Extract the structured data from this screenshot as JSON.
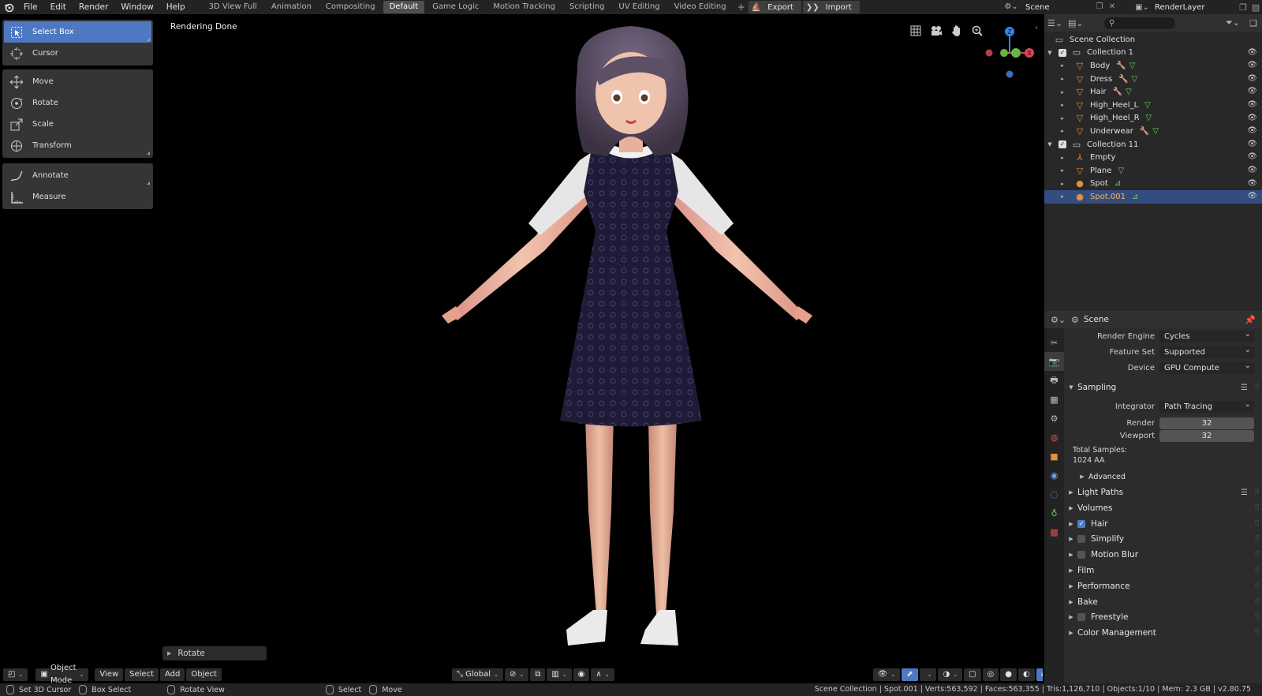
{
  "menu": [
    "File",
    "Edit",
    "Render",
    "Window",
    "Help"
  ],
  "workspaces": [
    {
      "label": "3D View Full",
      "active": false
    },
    {
      "label": "Animation",
      "active": false
    },
    {
      "label": "Compositing",
      "active": false
    },
    {
      "label": "Default",
      "active": true
    },
    {
      "label": "Game Logic",
      "active": false
    },
    {
      "label": "Motion Tracking",
      "active": false
    },
    {
      "label": "Scripting",
      "active": false
    },
    {
      "label": "UV Editing",
      "active": false
    },
    {
      "label": "Video Editing",
      "active": false
    }
  ],
  "topbar": {
    "export_label": "Export",
    "import_label": "Import",
    "scene_name": "Scene",
    "view_layer": "RenderLayer"
  },
  "viewport": {
    "status": "Rendering Done",
    "redo_panel": "Rotate"
  },
  "tools": [
    {
      "group": 1,
      "label": "Select Box",
      "icon": "select-box-icon",
      "active": true
    },
    {
      "group": 1,
      "label": "Cursor",
      "icon": "cursor-icon",
      "active": false
    },
    {
      "group": 2,
      "label": "Move",
      "icon": "move-icon",
      "active": false
    },
    {
      "group": 2,
      "label": "Rotate",
      "icon": "rotate-icon",
      "active": false
    },
    {
      "group": 2,
      "label": "Scale",
      "icon": "scale-icon",
      "active": false
    },
    {
      "group": 2,
      "label": "Transform",
      "icon": "transform-icon",
      "active": false
    },
    {
      "group": 3,
      "label": "Annotate",
      "icon": "annotate-icon",
      "active": false
    },
    {
      "group": 3,
      "label": "Measure",
      "icon": "measure-icon",
      "active": false
    }
  ],
  "gizmo": {
    "z": "Z",
    "x": "X"
  },
  "vp_header": {
    "mode": "Object Mode",
    "view": "View",
    "select": "Select",
    "add": "Add",
    "object": "Object",
    "orientation": "Global"
  },
  "outliner": {
    "root": "Scene Collection",
    "rows": [
      {
        "label": "Collection 1",
        "level": 1,
        "type": "collection",
        "expanded": true
      },
      {
        "label": "Body",
        "level": 2,
        "type": "mesh",
        "mods": [
          "wrench",
          "tri"
        ]
      },
      {
        "label": "Dress",
        "level": 2,
        "type": "mesh",
        "mods": [
          "wrench",
          "tri"
        ]
      },
      {
        "label": "Hair",
        "level": 2,
        "type": "mesh",
        "mods": [
          "wrench",
          "tri"
        ]
      },
      {
        "label": "High_Heel_L",
        "level": 2,
        "type": "mesh",
        "mods": [
          "tri"
        ]
      },
      {
        "label": "High_Heel_R",
        "level": 2,
        "type": "mesh",
        "mods": [
          "tri"
        ]
      },
      {
        "label": "Underwear",
        "level": 2,
        "type": "mesh",
        "mods": [
          "wrench",
          "tri"
        ]
      },
      {
        "label": "Collection 11",
        "level": 1,
        "type": "collection",
        "expanded": true
      },
      {
        "label": "Empty",
        "level": 2,
        "type": "empty",
        "mods": []
      },
      {
        "label": "Plane",
        "level": 2,
        "type": "mesh",
        "mods": [
          "tri"
        ]
      },
      {
        "label": "Spot",
        "level": 2,
        "type": "light",
        "mods": [
          "light-data"
        ]
      },
      {
        "label": "Spot.001",
        "level": 2,
        "type": "light",
        "mods": [
          "light-data"
        ],
        "selected": true
      }
    ]
  },
  "properties": {
    "context": "Scene",
    "render_engine": {
      "label": "Render Engine",
      "value": "Cycles"
    },
    "feature_set": {
      "label": "Feature Set",
      "value": "Supported"
    },
    "device": {
      "label": "Device",
      "value": "GPU Compute"
    },
    "sampling": {
      "title": "Sampling",
      "integrator": {
        "label": "Integrator",
        "value": "Path Tracing"
      },
      "render": {
        "label": "Render",
        "value": "32"
      },
      "viewport": {
        "label": "Viewport",
        "value": "32"
      },
      "total_label": "Total Samples:",
      "total_value": "1024 AA",
      "advanced": "Advanced"
    },
    "panels": [
      {
        "label": "Light Paths",
        "checkbox": null,
        "list_icon": true
      },
      {
        "label": "Volumes",
        "checkbox": null
      },
      {
        "label": "Hair",
        "checkbox": true
      },
      {
        "label": "Simplify",
        "checkbox": false
      },
      {
        "label": "Motion Blur",
        "checkbox": false
      },
      {
        "label": "Film",
        "checkbox": null
      },
      {
        "label": "Performance",
        "checkbox": null
      },
      {
        "label": "Bake",
        "checkbox": null
      },
      {
        "label": "Freestyle",
        "checkbox": false
      },
      {
        "label": "Color Management",
        "checkbox": null
      }
    ]
  },
  "statusbar": {
    "left": [
      {
        "label": "Set 3D Cursor"
      },
      {
        "label": "Box Select"
      },
      {
        "label": "Rotate View"
      },
      {
        "label": "Select"
      },
      {
        "label": "Move"
      }
    ],
    "stats": "Scene Collection | Spot.001 | Verts:563,592 | Faces:563,355 | Tris:1,126,710 | Objects:1/10 | Mem: 2.3 GB | v2.80.75"
  },
  "colors": {
    "accent": "#4f78c2",
    "selected_row": "#334d80",
    "mesh_icon": "#e0913a",
    "modifier_icon": "#6aa7ee",
    "data_icon": "#66d45c"
  }
}
